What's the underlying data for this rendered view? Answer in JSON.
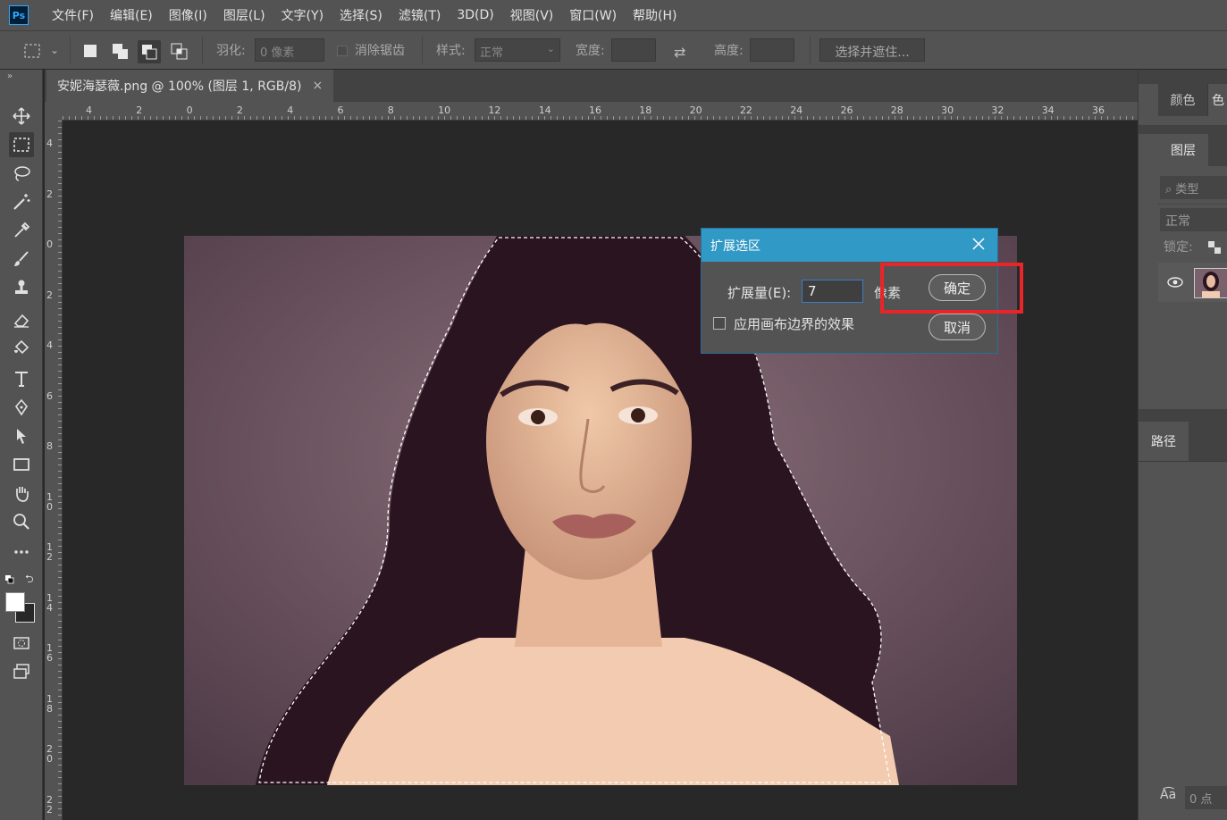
{
  "app": {
    "logo": "Ps"
  },
  "menu": [
    "文件(F)",
    "编辑(E)",
    "图像(I)",
    "图层(L)",
    "文字(Y)",
    "选择(S)",
    "滤镜(T)",
    "3D(D)",
    "视图(V)",
    "窗口(W)",
    "帮助(H)"
  ],
  "options": {
    "feather_label": "羽化:",
    "feather_value": "0 像素",
    "antialias_label": "消除锯齿",
    "style_label": "样式:",
    "style_value": "正常",
    "width_label": "宽度:",
    "height_label": "高度:",
    "select_mask_button": "选择并遮住..."
  },
  "document_tab": {
    "title": "安妮海瑟薇.png @ 100% (图层 1, RGB/8)",
    "close": "×"
  },
  "rulers": {
    "horizontal": [
      "4",
      "2",
      "0",
      "2",
      "4",
      "6",
      "8",
      "10",
      "12",
      "14",
      "16",
      "18",
      "20",
      "22",
      "24",
      "26",
      "28",
      "30",
      "32",
      "34",
      "36"
    ],
    "vertical": [
      "4",
      "2",
      "0",
      "2",
      "4",
      "6",
      "8",
      "1\n0",
      "1\n2",
      "1\n4",
      "1\n6",
      "1\n8",
      "2\n0",
      "2\n2"
    ]
  },
  "dialog": {
    "title": "扩展选区",
    "amount_label": "扩展量(E):",
    "amount_value": "7",
    "unit": "像素",
    "checkbox_label": "应用画布边界的效果",
    "ok": "确定",
    "cancel": "取消"
  },
  "panels": {
    "color_tab": "颜色",
    "color_tab2": "色",
    "layers_tab": "图层",
    "type_filter": "类型",
    "blend_mode": "正常",
    "lock_label": "锁定:",
    "paths_tab": "路径",
    "char_value": "0 点"
  },
  "colors": {
    "accent": "#3199c5",
    "highlight": "#e8262a"
  }
}
